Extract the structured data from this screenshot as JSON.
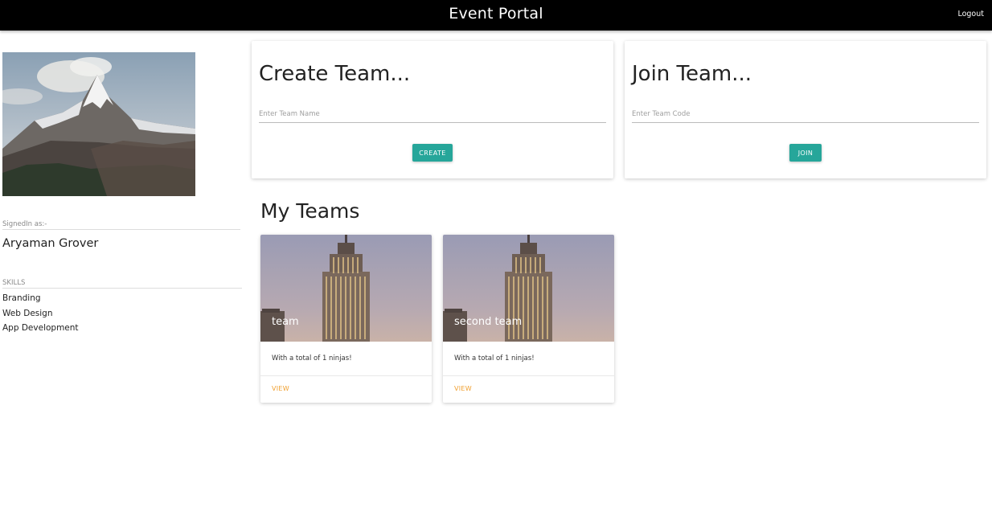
{
  "navbar": {
    "title": "Event Portal",
    "logout_label": "Logout"
  },
  "sidebar": {
    "signed_in_label": "SignedIn as:-",
    "user_name": "Aryaman Grover",
    "skills_label": "SKILLS",
    "skills": [
      "Branding",
      "Web Design",
      "App Development"
    ]
  },
  "create_team": {
    "title": "Create Team...",
    "placeholder": "Enter Team Name",
    "value": "",
    "button_label": "CREATE"
  },
  "join_team": {
    "title": "Join Team...",
    "placeholder": "Enter Team Code",
    "value": "",
    "button_label": "JOIN"
  },
  "my_teams": {
    "title": "My Teams",
    "teams": [
      {
        "name": "team",
        "description": "With a total of 1 ninjas!",
        "action_label": "VIEW"
      },
      {
        "name": "second team",
        "description": "With a total of 1 ninjas!",
        "action_label": "VIEW"
      }
    ]
  },
  "colors": {
    "navbar_bg": "#000000",
    "accent": "#26a69a",
    "link": "#f0a030"
  }
}
